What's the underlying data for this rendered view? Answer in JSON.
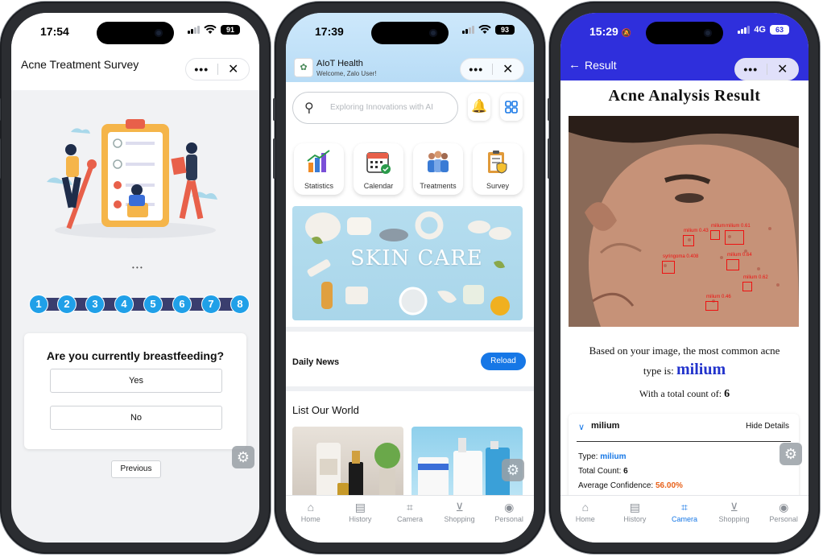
{
  "phone1": {
    "status": {
      "time": "17:54",
      "battery": "91"
    },
    "title": "Acne Treatment Survey",
    "capsule": {
      "more": "•••",
      "close": "✕"
    },
    "loading": "• • •",
    "steps": [
      "1",
      "2",
      "3",
      "4",
      "5",
      "6",
      "7",
      "8"
    ],
    "question": "Are you currently breastfeeding?",
    "options": [
      "Yes",
      "No"
    ],
    "previous": "Previous"
  },
  "phone2": {
    "status": {
      "time": "17:39",
      "battery": "93"
    },
    "app_name": "AIoT Health",
    "welcome": "Welcome, Zalo User!",
    "search_placeholder": "Exploring Innovations with AI",
    "categories": [
      "Statistics",
      "Calendar",
      "Treatments",
      "Survey"
    ],
    "banner_text": "SKIN CARE",
    "daily_news": "Daily News",
    "reload": "Reload",
    "list_world": "List Our World",
    "tabs": [
      "Home",
      "History",
      "Camera",
      "Shopping",
      "Personal"
    ]
  },
  "phone3": {
    "status": {
      "time": "15:29",
      "network": "4G",
      "battery": "63"
    },
    "back": "←",
    "title": "Result",
    "heading": "Acne Analysis Result",
    "result_line1": "Based on your image, the most common acne",
    "result_line2_prefix": "type is:",
    "result_type": "milium",
    "result_line3_prefix": "With a total count of:",
    "result_count": "6",
    "detections": [
      {
        "label": "milium 0.43"
      },
      {
        "label": "milium"
      },
      {
        "label": "milium 0.61"
      },
      {
        "label": "syringoma 0.408"
      },
      {
        "label": "milium 0.64"
      },
      {
        "label": "milium 0.62"
      },
      {
        "label": "milium 0.46"
      }
    ],
    "detail": {
      "name": "milium",
      "hide": "Hide Details",
      "type_label": "Type:",
      "type_value": "milium",
      "count_label": "Total Count:",
      "count_value": "6",
      "conf_label": "Average Confidence:",
      "conf_value": "56.00%"
    },
    "tabs": [
      "Home",
      "History",
      "Camera",
      "Shopping",
      "Personal"
    ],
    "active_tab": "Camera"
  }
}
